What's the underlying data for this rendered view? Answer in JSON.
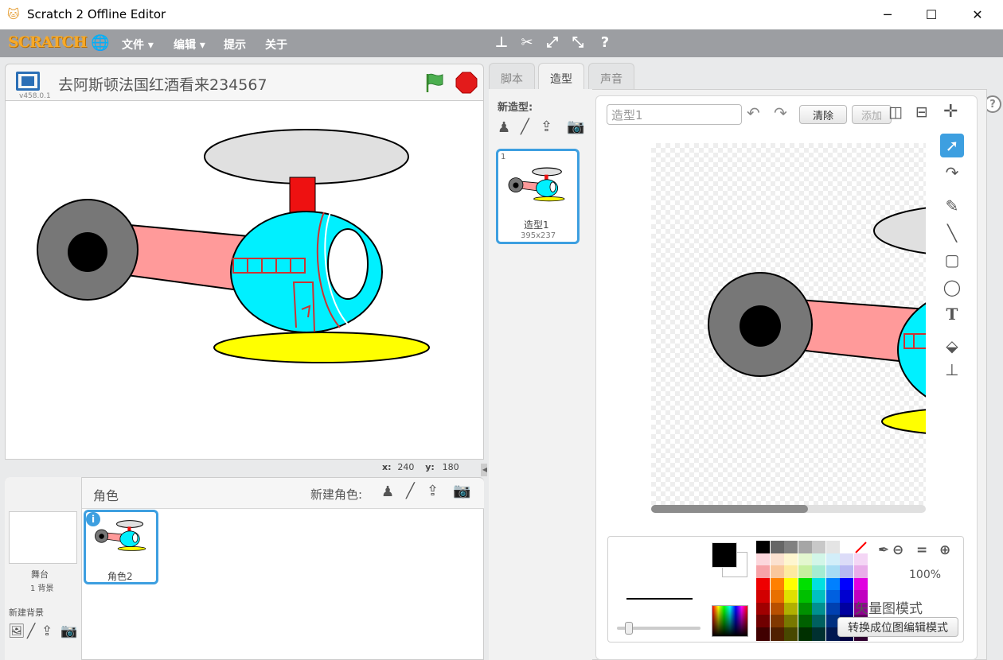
{
  "window": {
    "title": "Scratch 2 Offline Editor",
    "minimize": "─",
    "maximize": "☐",
    "close": "✕"
  },
  "menu": {
    "logo": "SCRATCH",
    "file": "文件 ▾",
    "edit": "编辑 ▾",
    "tips": "提示",
    "about": "关于"
  },
  "stage": {
    "project_title": "去阿斯顿法国红酒看来234567",
    "version": "v458.0.1",
    "x_label": "x:",
    "x_value": "240",
    "y_label": "y:",
    "y_value": "180"
  },
  "sprites": {
    "header": "角色",
    "new_sprite": "新建角色:",
    "stage_label": "舞台",
    "backdrop_count": "1 背景",
    "new_backdrop": "新建背景",
    "items": [
      {
        "name": "角色2"
      }
    ]
  },
  "tabs": {
    "scripts": "脚本",
    "costumes": "造型",
    "sounds": "声音"
  },
  "costumes": {
    "new_costume": "新造型:",
    "items": [
      {
        "index": "1",
        "name": "造型1",
        "size": "395x237"
      }
    ]
  },
  "editor": {
    "costume_name_value": "造型1",
    "clear": "清除",
    "add": "添加",
    "zoom": "100%",
    "mode_label": "矢量图模式",
    "convert_button": "转换成位图编辑模式"
  },
  "colors": {
    "menubar": "#9c9ea2",
    "accent": "#3d9fe0",
    "palette": [
      [
        "#000000",
        "#666666",
        "#808080",
        "#a6a6a6",
        "#c8c8c8",
        "#e4e4e4",
        "#ffffff",
        "#ff0000"
      ],
      [
        "#fcd7dc",
        "#fbe1cf",
        "#fef6cf",
        "#e3f7cf",
        "#d2f6e8",
        "#d2eef9",
        "#dcdcf8",
        "#f4d6f5"
      ],
      [
        "#f7a3a8",
        "#f9c79b",
        "#fdeaa0",
        "#c6ef9f",
        "#a5ecd2",
        "#a7dcf4",
        "#b8b8f2",
        "#e9ade9"
      ],
      [
        "#ef0000",
        "#ff8000",
        "#ffff00",
        "#00e000",
        "#00e0e0",
        "#0080ff",
        "#0000ff",
        "#e000e0"
      ],
      [
        "#d20000",
        "#e87000",
        "#e0e000",
        "#00c000",
        "#00c0c0",
        "#0060e0",
        "#0000d0",
        "#c000c0"
      ],
      [
        "#a00000",
        "#b85000",
        "#b0b000",
        "#009000",
        "#009090",
        "#0040b0",
        "#0000a0",
        "#900090"
      ],
      [
        "#700000",
        "#803800",
        "#787800",
        "#006000",
        "#006060",
        "#003080",
        "#000070",
        "#600060"
      ],
      [
        "#400000",
        "#502000",
        "#484800",
        "#003000",
        "#003030",
        "#001850",
        "#000040",
        "#300030"
      ]
    ]
  }
}
